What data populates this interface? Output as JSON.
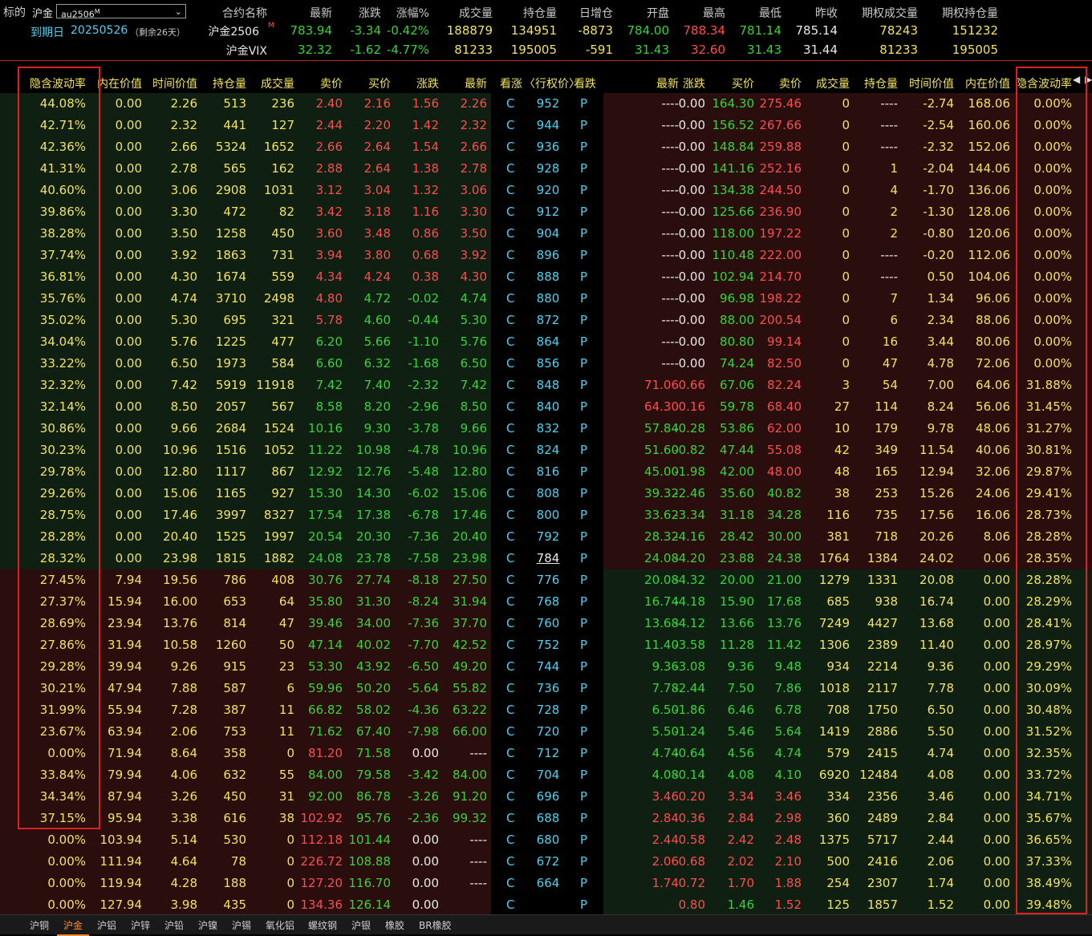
{
  "header": {
    "underlying_label": "标的",
    "exchange": "沪金",
    "symbol": "au2506",
    "symbol_suffix": "M",
    "expiry_label": "到期日",
    "expiry_date": "20250526",
    "remaining": "（剩余26天）",
    "columns": [
      "合约名称",
      "最新",
      "涨跌",
      "涨幅%",
      "成交量",
      "持仓量",
      "日增仓",
      "开盘",
      "最高",
      "最低",
      "昨收",
      "期权成交量",
      "期权持仓量"
    ],
    "rows": [
      {
        "name": "沪金2506",
        "sup": "M",
        "last": "783.94",
        "chg": "-3.34",
        "pct": "-0.42%",
        "vol": "188879",
        "oi": "134951",
        "dinc": "-8873",
        "open": "784.00",
        "high": "788.34",
        "low": "781.14",
        "prev": "785.14",
        "optvol": "78243",
        "optoi": "151232"
      },
      {
        "name": "沪金VIX",
        "sup": "",
        "last": "32.32",
        "chg": "-1.62",
        "pct": "-4.77%",
        "vol": "81233",
        "oi": "195005",
        "dinc": "-591",
        "open": "31.43",
        "high": "32.60",
        "low": "31.43",
        "prev": "31.44",
        "optvol": "81233",
        "optoi": "195005"
      }
    ]
  },
  "table": {
    "call_columns": [
      "隐含波动率",
      "内在价值",
      "时间价值",
      "持仓量",
      "成交量",
      "卖价",
      "买价",
      "涨跌",
      "最新"
    ],
    "mid_columns": [
      "看涨",
      "〈行权价〉",
      "看跌"
    ],
    "put_columns": [
      "最新",
      "涨跌",
      "买价",
      "卖价",
      "成交量",
      "持仓量",
      "时间价值",
      "内在价值",
      "隐含波动率"
    ],
    "underlined_strike": "784",
    "rows": [
      {
        "c": [
          "44.08%",
          "0.00",
          "2.26",
          "513",
          "236",
          "2.40",
          "2.16",
          "1.56",
          "2.26"
        ],
        "k": "952",
        "p": [
          "----",
          "0.00",
          "164.30",
          "275.46",
          "0",
          "----",
          "-2.74",
          "168.06",
          "0.00%"
        ]
      },
      {
        "c": [
          "42.71%",
          "0.00",
          "2.32",
          "441",
          "127",
          "2.44",
          "2.20",
          "1.42",
          "2.32"
        ],
        "k": "944",
        "p": [
          "----",
          "0.00",
          "156.52",
          "267.66",
          "0",
          "----",
          "-2.54",
          "160.06",
          "0.00%"
        ]
      },
      {
        "c": [
          "42.36%",
          "0.00",
          "2.66",
          "5324",
          "1652",
          "2.66",
          "2.64",
          "1.54",
          "2.66"
        ],
        "k": "936",
        "p": [
          "----",
          "0.00",
          "148.84",
          "259.88",
          "0",
          "----",
          "-2.32",
          "152.06",
          "0.00%"
        ]
      },
      {
        "c": [
          "41.31%",
          "0.00",
          "2.78",
          "565",
          "162",
          "2.88",
          "2.64",
          "1.38",
          "2.78"
        ],
        "k": "928",
        "p": [
          "----",
          "0.00",
          "141.16",
          "252.16",
          "0",
          "1",
          "-2.04",
          "144.06",
          "0.00%"
        ]
      },
      {
        "c": [
          "40.60%",
          "0.00",
          "3.06",
          "2908",
          "1031",
          "3.12",
          "3.04",
          "1.32",
          "3.06"
        ],
        "k": "920",
        "p": [
          "----",
          "0.00",
          "134.38",
          "244.50",
          "0",
          "4",
          "-1.70",
          "136.06",
          "0.00%"
        ]
      },
      {
        "c": [
          "39.86%",
          "0.00",
          "3.30",
          "472",
          "82",
          "3.42",
          "3.18",
          "1.16",
          "3.30"
        ],
        "k": "912",
        "p": [
          "----",
          "0.00",
          "125.66",
          "236.90",
          "0",
          "2",
          "-1.30",
          "128.06",
          "0.00%"
        ]
      },
      {
        "c": [
          "38.28%",
          "0.00",
          "3.50",
          "1258",
          "450",
          "3.60",
          "3.48",
          "0.86",
          "3.50"
        ],
        "k": "904",
        "p": [
          "----",
          "0.00",
          "118.00",
          "197.22",
          "0",
          "2",
          "-0.80",
          "120.06",
          "0.00%"
        ]
      },
      {
        "c": [
          "37.74%",
          "0.00",
          "3.92",
          "1863",
          "731",
          "3.94",
          "3.80",
          "0.68",
          "3.92"
        ],
        "k": "896",
        "p": [
          "----",
          "0.00",
          "110.48",
          "222.00",
          "0",
          "----",
          "-0.20",
          "112.06",
          "0.00%"
        ]
      },
      {
        "c": [
          "36.81%",
          "0.00",
          "4.30",
          "1674",
          "559",
          "4.34",
          "4.24",
          "0.38",
          "4.30"
        ],
        "k": "888",
        "p": [
          "----",
          "0.00",
          "102.94",
          "214.70",
          "0",
          "----",
          "0.50",
          "104.06",
          "0.00%"
        ]
      },
      {
        "c": [
          "35.76%",
          "0.00",
          "4.74",
          "3710",
          "2498",
          "4.80",
          "4.72",
          "-0.02",
          "4.74"
        ],
        "k": "880",
        "p": [
          "----",
          "0.00",
          "96.98",
          "198.22",
          "0",
          "7",
          "1.34",
          "96.06",
          "0.00%"
        ]
      },
      {
        "c": [
          "35.02%",
          "0.00",
          "5.30",
          "695",
          "321",
          "5.78",
          "4.60",
          "-0.44",
          "5.30"
        ],
        "k": "872",
        "p": [
          "----",
          "0.00",
          "88.00",
          "200.54",
          "0",
          "6",
          "2.34",
          "88.06",
          "0.00%"
        ]
      },
      {
        "c": [
          "34.04%",
          "0.00",
          "5.76",
          "1225",
          "477",
          "6.20",
          "5.66",
          "-1.10",
          "5.76"
        ],
        "k": "864",
        "p": [
          "----",
          "0.00",
          "80.80",
          "99.14",
          "0",
          "16",
          "3.44",
          "80.06",
          "0.00%"
        ]
      },
      {
        "c": [
          "33.22%",
          "0.00",
          "6.50",
          "1973",
          "584",
          "6.60",
          "6.32",
          "-1.68",
          "6.50"
        ],
        "k": "856",
        "p": [
          "----",
          "0.00",
          "74.24",
          "82.50",
          "0",
          "47",
          "4.78",
          "72.06",
          "0.00%"
        ]
      },
      {
        "c": [
          "32.32%",
          "0.00",
          "7.42",
          "5919",
          "11918",
          "7.42",
          "7.40",
          "-2.32",
          "7.42"
        ],
        "k": "848",
        "p": [
          "71.06",
          "0.66",
          "67.06",
          "82.24",
          "3",
          "54",
          "7.00",
          "64.06",
          "31.88%"
        ]
      },
      {
        "c": [
          "32.14%",
          "0.00",
          "8.50",
          "2057",
          "567",
          "8.58",
          "8.20",
          "-2.96",
          "8.50"
        ],
        "k": "840",
        "p": [
          "64.30",
          "0.16",
          "59.78",
          "68.40",
          "27",
          "114",
          "8.24",
          "56.06",
          "31.45%"
        ]
      },
      {
        "c": [
          "30.86%",
          "0.00",
          "9.66",
          "2684",
          "1524",
          "10.16",
          "9.30",
          "-3.78",
          "9.66"
        ],
        "k": "832",
        "p": [
          "57.84",
          "-0.28",
          "53.86",
          "62.00",
          "10",
          "179",
          "9.78",
          "48.06",
          "31.27%"
        ]
      },
      {
        "c": [
          "30.23%",
          "0.00",
          "10.96",
          "1516",
          "1052",
          "11.22",
          "10.98",
          "-4.78",
          "10.96"
        ],
        "k": "824",
        "p": [
          "51.60",
          "-0.82",
          "47.44",
          "55.08",
          "42",
          "349",
          "11.54",
          "40.06",
          "30.81%"
        ]
      },
      {
        "c": [
          "29.78%",
          "0.00",
          "12.80",
          "1117",
          "867",
          "12.92",
          "12.76",
          "-5.48",
          "12.80"
        ],
        "k": "816",
        "p": [
          "45.00",
          "-1.98",
          "42.00",
          "48.00",
          "48",
          "165",
          "12.94",
          "32.06",
          "29.87%"
        ]
      },
      {
        "c": [
          "29.26%",
          "0.00",
          "15.06",
          "1165",
          "927",
          "15.30",
          "14.30",
          "-6.02",
          "15.06"
        ],
        "k": "808",
        "p": [
          "39.32",
          "-2.46",
          "35.60",
          "40.82",
          "38",
          "253",
          "15.26",
          "24.06",
          "29.41%"
        ]
      },
      {
        "c": [
          "28.75%",
          "0.00",
          "17.46",
          "3997",
          "8327",
          "17.54",
          "17.38",
          "-6.78",
          "17.46"
        ],
        "k": "800",
        "p": [
          "33.62",
          "-3.34",
          "31.18",
          "34.28",
          "116",
          "735",
          "17.56",
          "16.06",
          "28.73%"
        ]
      },
      {
        "c": [
          "28.28%",
          "0.00",
          "20.40",
          "1525",
          "1997",
          "20.54",
          "20.30",
          "-7.36",
          "20.40"
        ],
        "k": "792",
        "p": [
          "28.32",
          "-4.16",
          "28.42",
          "30.00",
          "381",
          "718",
          "20.26",
          "8.06",
          "28.28%"
        ]
      },
      {
        "c": [
          "28.32%",
          "0.00",
          "23.98",
          "1815",
          "1882",
          "24.08",
          "23.78",
          "-7.58",
          "23.98"
        ],
        "k": "784",
        "p": [
          "24.08",
          "-4.20",
          "23.88",
          "24.38",
          "1764",
          "1384",
          "24.02",
          "0.06",
          "28.35%"
        ]
      },
      {
        "c": [
          "27.45%",
          "7.94",
          "19.56",
          "786",
          "408",
          "30.76",
          "27.74",
          "-8.18",
          "27.50"
        ],
        "k": "776",
        "p": [
          "20.08",
          "-4.32",
          "20.00",
          "21.00",
          "1279",
          "1331",
          "20.08",
          "0.00",
          "28.28%"
        ]
      },
      {
        "c": [
          "27.37%",
          "15.94",
          "16.00",
          "653",
          "64",
          "35.80",
          "31.30",
          "-8.24",
          "31.94"
        ],
        "k": "768",
        "p": [
          "16.74",
          "-4.18",
          "15.90",
          "17.68",
          "685",
          "938",
          "16.74",
          "0.00",
          "28.29%"
        ]
      },
      {
        "c": [
          "28.69%",
          "23.94",
          "13.76",
          "814",
          "47",
          "39.46",
          "34.00",
          "-7.36",
          "37.70"
        ],
        "k": "760",
        "p": [
          "13.68",
          "-4.12",
          "13.66",
          "13.76",
          "7249",
          "4427",
          "13.68",
          "0.00",
          "28.41%"
        ]
      },
      {
        "c": [
          "27.86%",
          "31.94",
          "10.58",
          "1260",
          "50",
          "47.14",
          "40.02",
          "-7.70",
          "42.52"
        ],
        "k": "752",
        "p": [
          "11.40",
          "-3.58",
          "11.28",
          "11.42",
          "1306",
          "2389",
          "11.40",
          "0.00",
          "28.97%"
        ]
      },
      {
        "c": [
          "29.28%",
          "39.94",
          "9.26",
          "915",
          "23",
          "53.30",
          "43.92",
          "-6.50",
          "49.20"
        ],
        "k": "744",
        "p": [
          "9.36",
          "-3.08",
          "9.36",
          "9.48",
          "934",
          "2214",
          "9.36",
          "0.00",
          "29.29%"
        ]
      },
      {
        "c": [
          "30.21%",
          "47.94",
          "7.88",
          "587",
          "6",
          "59.96",
          "50.20",
          "-5.64",
          "55.82"
        ],
        "k": "736",
        "p": [
          "7.78",
          "-2.44",
          "7.50",
          "7.86",
          "1018",
          "2117",
          "7.78",
          "0.00",
          "30.09%"
        ]
      },
      {
        "c": [
          "31.99%",
          "55.94",
          "7.28",
          "387",
          "11",
          "66.82",
          "58.02",
          "-4.36",
          "63.22"
        ],
        "k": "728",
        "p": [
          "6.50",
          "-1.86",
          "6.46",
          "6.78",
          "708",
          "1750",
          "6.50",
          "0.00",
          "30.48%"
        ]
      },
      {
        "c": [
          "23.67%",
          "63.94",
          "2.06",
          "753",
          "11",
          "71.62",
          "67.40",
          "-7.98",
          "66.00"
        ],
        "k": "720",
        "p": [
          "5.50",
          "-1.24",
          "5.46",
          "5.64",
          "1419",
          "2886",
          "5.50",
          "0.00",
          "31.52%"
        ]
      },
      {
        "c": [
          "0.00%",
          "71.94",
          "8.64",
          "358",
          "0",
          "81.20",
          "71.58",
          "0.00",
          "----"
        ],
        "k": "712",
        "p": [
          "4.74",
          "-0.64",
          "4.56",
          "4.74",
          "579",
          "2415",
          "4.74",
          "0.00",
          "32.35%"
        ]
      },
      {
        "c": [
          "33.84%",
          "79.94",
          "4.06",
          "632",
          "55",
          "84.00",
          "79.58",
          "-3.42",
          "84.00"
        ],
        "k": "704",
        "p": [
          "4.08",
          "-0.14",
          "4.08",
          "4.10",
          "6920",
          "12484",
          "4.08",
          "0.00",
          "33.72%"
        ]
      },
      {
        "c": [
          "34.34%",
          "87.94",
          "3.26",
          "450",
          "31",
          "92.00",
          "86.78",
          "-3.26",
          "91.20"
        ],
        "k": "696",
        "p": [
          "3.46",
          "0.20",
          "3.34",
          "3.46",
          "334",
          "2356",
          "3.46",
          "0.00",
          "34.71%"
        ]
      },
      {
        "c": [
          "37.15%",
          "95.94",
          "3.38",
          "616",
          "38",
          "102.92",
          "95.76",
          "-2.36",
          "99.32"
        ],
        "k": "688",
        "p": [
          "2.84",
          "0.36",
          "2.84",
          "2.98",
          "360",
          "2489",
          "2.84",
          "0.00",
          "35.67%"
        ]
      },
      {
        "c": [
          "0.00%",
          "103.94",
          "5.14",
          "530",
          "0",
          "112.18",
          "101.44",
          "0.00",
          "----"
        ],
        "k": "680",
        "p": [
          "2.44",
          "0.58",
          "2.42",
          "2.48",
          "1375",
          "5717",
          "2.44",
          "0.00",
          "36.65%"
        ]
      },
      {
        "c": [
          "0.00%",
          "111.94",
          "4.64",
          "78",
          "0",
          "226.72",
          "108.88",
          "0.00",
          "----"
        ],
        "k": "672",
        "p": [
          "2.06",
          "0.68",
          "2.02",
          "2.10",
          "500",
          "2416",
          "2.06",
          "0.00",
          "37.33%"
        ]
      },
      {
        "c": [
          "0.00%",
          "119.94",
          "4.28",
          "188",
          "0",
          "127.20",
          "116.70",
          "0.00",
          "----"
        ],
        "k": "664",
        "p": [
          "1.74",
          "0.72",
          "1.70",
          "1.88",
          "254",
          "2307",
          "1.74",
          "0.00",
          "38.49%"
        ]
      },
      {
        "c": [
          "0.00%",
          "127.94",
          "3.98",
          "435",
          "0",
          "134.36",
          "126.14",
          "0.00",
          ""
        ],
        "k": "",
        "p": [
          "",
          "0.80",
          "1.46",
          "1.52",
          "125",
          "1857",
          "1.52",
          "0.00",
          "39.48%"
        ]
      }
    ]
  },
  "tabs": [
    "沪铜",
    "沪金",
    "沪铝",
    "沪锌",
    "沪铅",
    "沪镍",
    "沪锡",
    "氧化铝",
    "螺纹钢",
    "沪银",
    "橡胶",
    "BR橡胶"
  ],
  "active_tab": "沪金",
  "colors": {
    "red": "#ff4c4c",
    "green": "#36d436",
    "yellow": "#f3e35a",
    "cyan": "#4fd0f0",
    "itm_bg": "#0f1f12",
    "otm_bg": "#2a0e0e"
  }
}
